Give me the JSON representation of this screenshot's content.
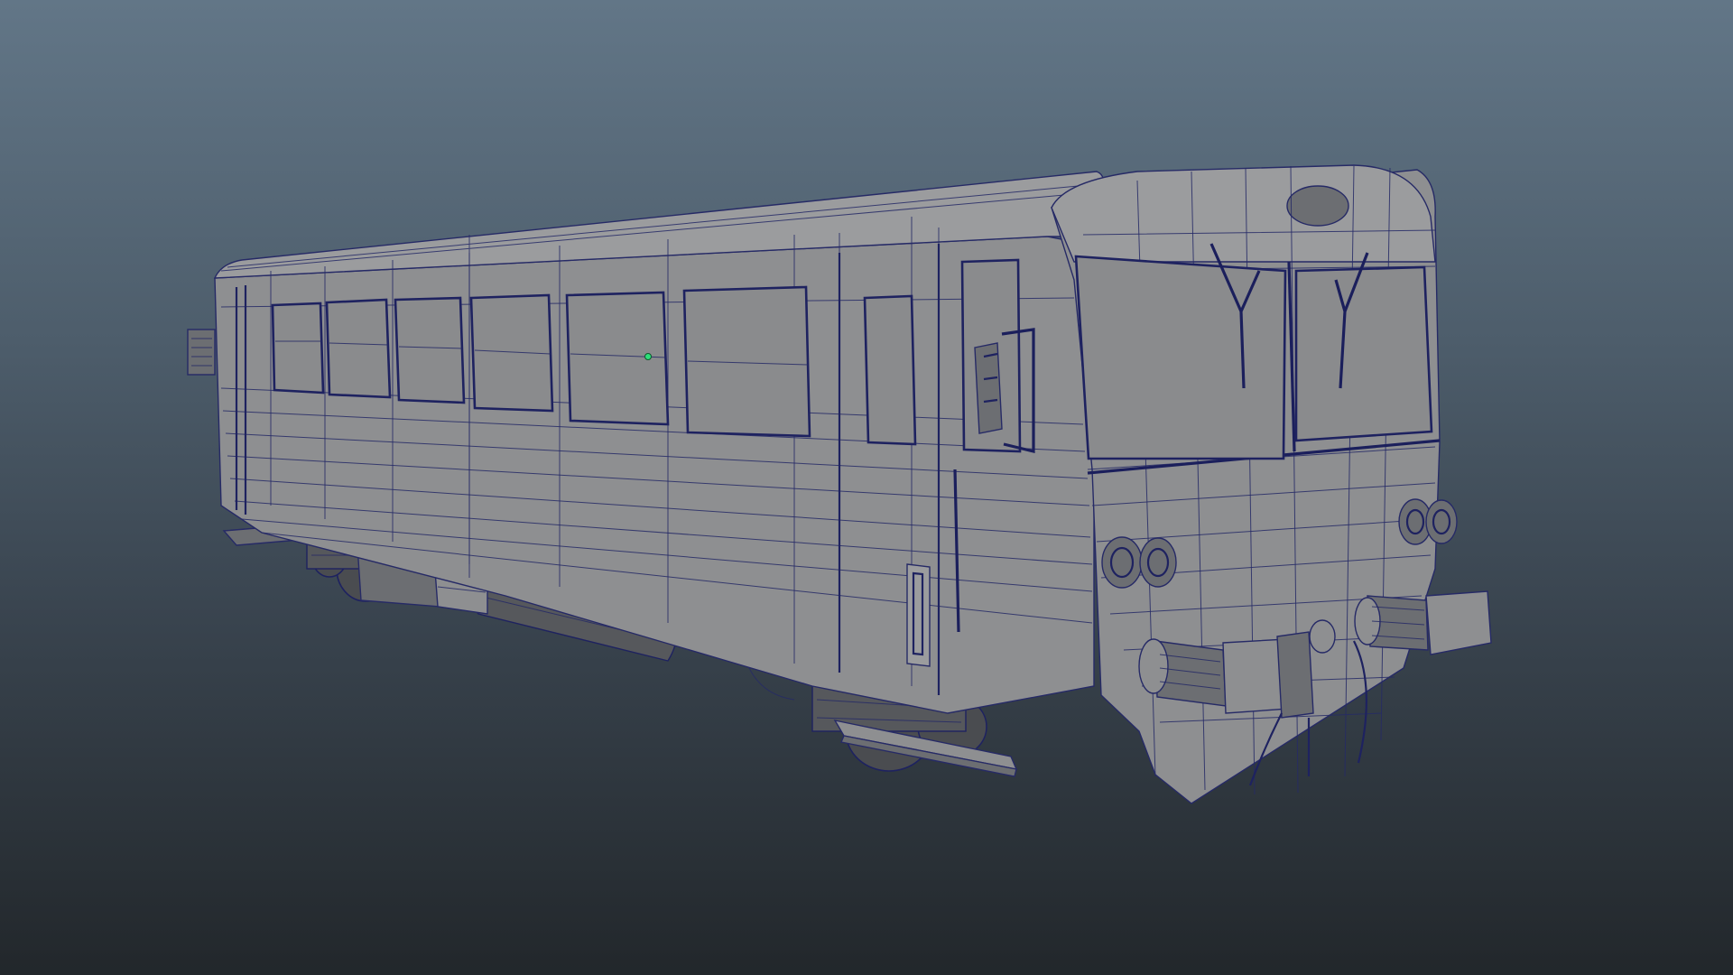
{
  "viewport": {
    "background_top": "#627687",
    "background_bottom": "#22272b",
    "mesh_fill": "#8e8f91",
    "wireframe_color": "#262a66",
    "selection_dot_color": "#2ee07a"
  }
}
